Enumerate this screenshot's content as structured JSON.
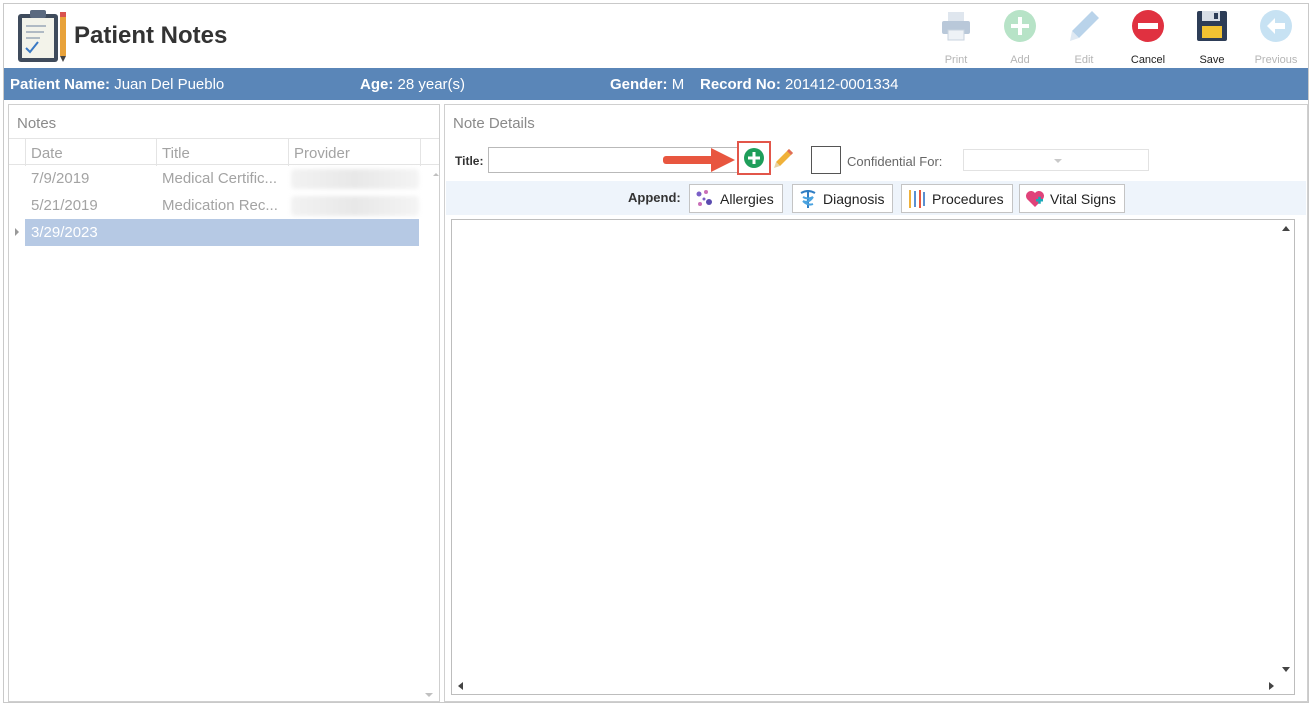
{
  "app": {
    "title": "Patient Notes",
    "logo_icon": "clipboard-notes-icon"
  },
  "toolbar": {
    "buttons": [
      {
        "label": "Print",
        "icon": "printer-icon",
        "enabled": false
      },
      {
        "label": "Add",
        "icon": "plus-circle-icon",
        "enabled": false
      },
      {
        "label": "Edit",
        "icon": "pencil-icon",
        "enabled": false
      },
      {
        "label": "Cancel",
        "icon": "minus-circle-icon",
        "enabled": true
      },
      {
        "label": "Save",
        "icon": "floppy-disk-icon",
        "enabled": true
      },
      {
        "label": "Previous",
        "icon": "arrow-left-circle-icon",
        "enabled": false
      }
    ]
  },
  "patient": {
    "name_label": "Patient Name:",
    "name": "Juan Del Pueblo",
    "age_label": "Age:",
    "age": "28 year(s)",
    "gender_label": "Gender:",
    "gender": "M",
    "record_label": "Record No:",
    "record": "201412-0001334"
  },
  "notes": {
    "title": "Notes",
    "columns": [
      "Date",
      "Title",
      "Provider"
    ],
    "rows": [
      {
        "date": "7/9/2019",
        "title": "Medical Certific...",
        "provider_blurred": true
      },
      {
        "date": "5/21/2019",
        "title": "Medication Rec...",
        "provider_blurred": true
      },
      {
        "date": "3/29/2023",
        "title": "",
        "selected": true
      }
    ]
  },
  "details": {
    "title": "Note Details",
    "title_label": "Title:",
    "title_value": "",
    "confidential_label": "Confidential For:",
    "confidential_value": "",
    "append_label": "Append:",
    "append_buttons": [
      {
        "label": "Allergies",
        "icon": "pills-icon"
      },
      {
        "label": "Diagnosis",
        "icon": "caduceus-icon"
      },
      {
        "label": "Procedures",
        "icon": "surgical-tools-icon"
      },
      {
        "label": "Vital Signs",
        "icon": "heart-pulse-icon"
      }
    ],
    "note_body": ""
  },
  "colors": {
    "patient_bar": "#5a86b8",
    "selected_row": "#b6c9e4",
    "highlight_box": "#e2564a",
    "add_green": "#1e9e5a",
    "cancel_red": "#e03140"
  }
}
